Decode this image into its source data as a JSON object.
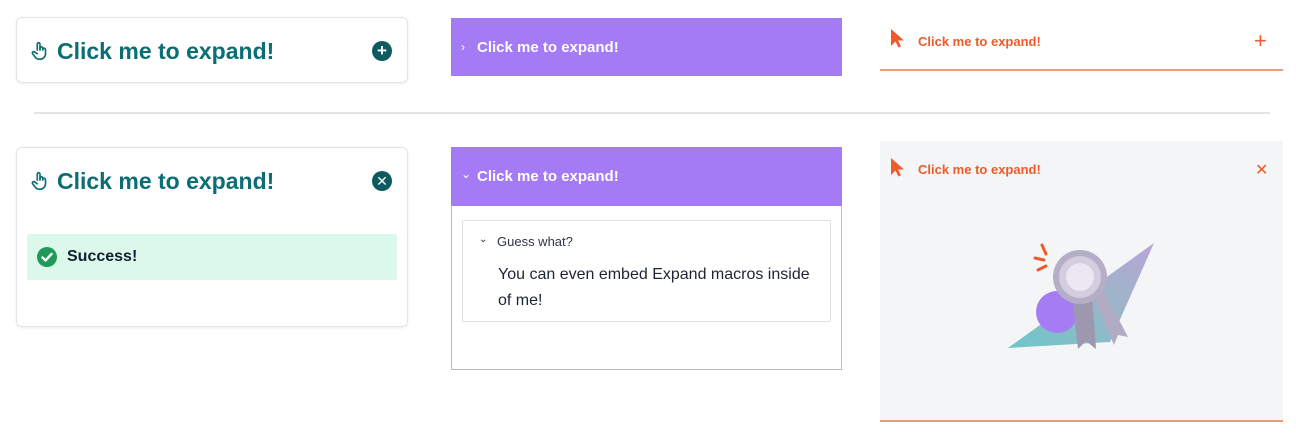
{
  "expanders": {
    "teal_collapsed": {
      "title": "Click me to expand!",
      "toggle_icon": "plus-circle-icon"
    },
    "purple_collapsed": {
      "title": "Click me to expand!",
      "chevron": "›"
    },
    "orange_collapsed": {
      "title": "Click me to expand!",
      "toggle_glyph": "+"
    },
    "teal_expanded": {
      "title": "Click me to expand!",
      "toggle_icon": "close-circle-icon",
      "success_label": "Success!"
    },
    "purple_expanded": {
      "title": "Click me to expand!",
      "chevron": "⌄",
      "nested": {
        "title": "Guess what?",
        "chevron": "⌄",
        "body": "You can even embed Expand macros inside of me!"
      }
    },
    "orange_expanded": {
      "title": "Click me to expand!",
      "toggle_glyph": "✕",
      "illustration": "award-ribbon-illustration"
    }
  },
  "colors": {
    "teal": "#0b6e74",
    "purple": "#a47af5",
    "orange": "#ee5b2a",
    "success_bg": "#dcf8ea",
    "success_icon": "#1f9a57"
  }
}
